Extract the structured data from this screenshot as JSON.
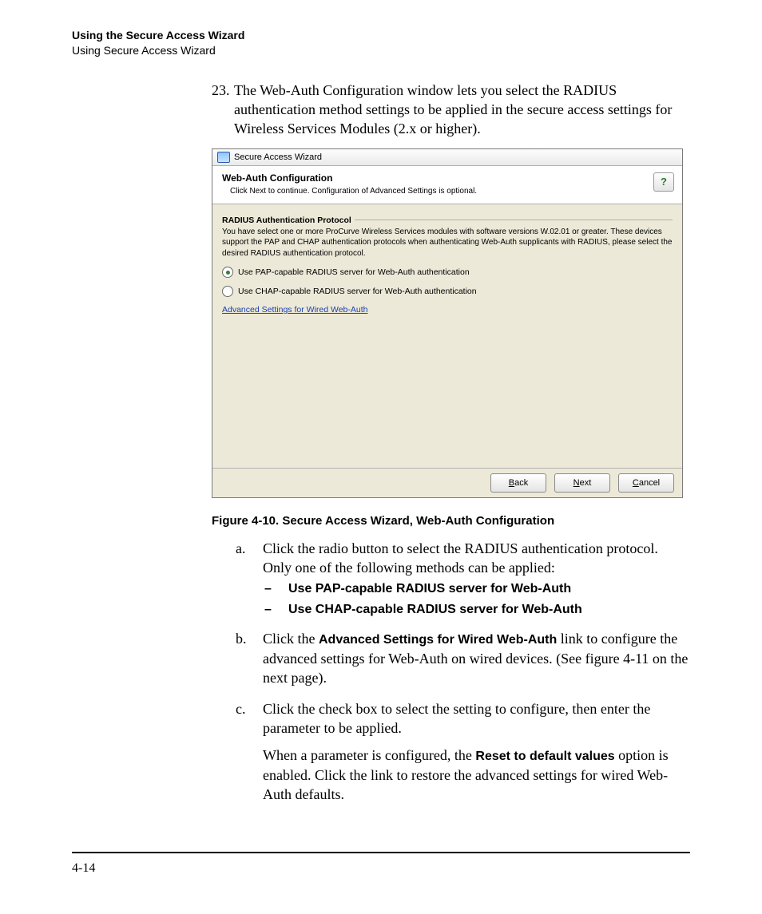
{
  "header": {
    "title": "Using the Secure Access Wizard",
    "subtitle": "Using Secure Access Wizard"
  },
  "step23": {
    "number": "23.",
    "text": "The Web-Auth Configuration window lets you select the RADIUS authentication method settings to be applied in the secure access settings for Wireless Services Modules (2.x or higher)."
  },
  "wizard": {
    "window_title": "Secure Access Wizard",
    "panel_title": "Web-Auth Configuration",
    "panel_subtitle": "Click Next to continue. Configuration of Advanced Settings is optional.",
    "group_title": "RADIUS Authentication Protocol",
    "group_text": "You have select one or more ProCurve Wireless Services modules with software versions W.02.01 or greater. These devices support the PAP and CHAP authentication protocols when authenticating Web-Auth supplicants with RADIUS, please select the desired RADIUS authentication protocol.",
    "radio_pap": "Use PAP-capable RADIUS server for Web-Auth authentication",
    "radio_chap": "Use CHAP-capable RADIUS server for Web-Auth authentication",
    "advanced_link": "Advanced Settings for Wired Web-Auth",
    "help_glyph": "?",
    "btn_back_u": "B",
    "btn_back_rest": "ack",
    "btn_next_u": "N",
    "btn_next_rest": "ext",
    "btn_cancel_u": "C",
    "btn_cancel_rest": "ancel"
  },
  "figure_caption": "Figure 4-10. Secure Access Wizard, Web-Auth Configuration",
  "item_a": {
    "label": "a.",
    "text": "Click the radio button to select the RADIUS authentication protocol. Only one of the following methods can be applied:",
    "dash1": "Use PAP-capable RADIUS server for Web-Auth",
    "dash2": "Use CHAP-capable RADIUS server for Web-Auth"
  },
  "item_b": {
    "label": "b.",
    "pre": "Click the ",
    "bold": "Advanced Settings for Wired Web-Auth",
    "post": " link to configure the advanced settings for Web-Auth on wired devices. (See figure 4-11 on the next page)."
  },
  "item_c": {
    "label": "c.",
    "text1": "Click the check box to select the setting to configure, then enter the parameter to be applied.",
    "text2_pre": "When a parameter is configured, the ",
    "text2_bold": "Reset to default values",
    "text2_post": " option is enabled. Click the link to restore the advanced settings for wired Web-Auth defaults."
  },
  "page_number": "4-14",
  "dash_glyph": "–"
}
